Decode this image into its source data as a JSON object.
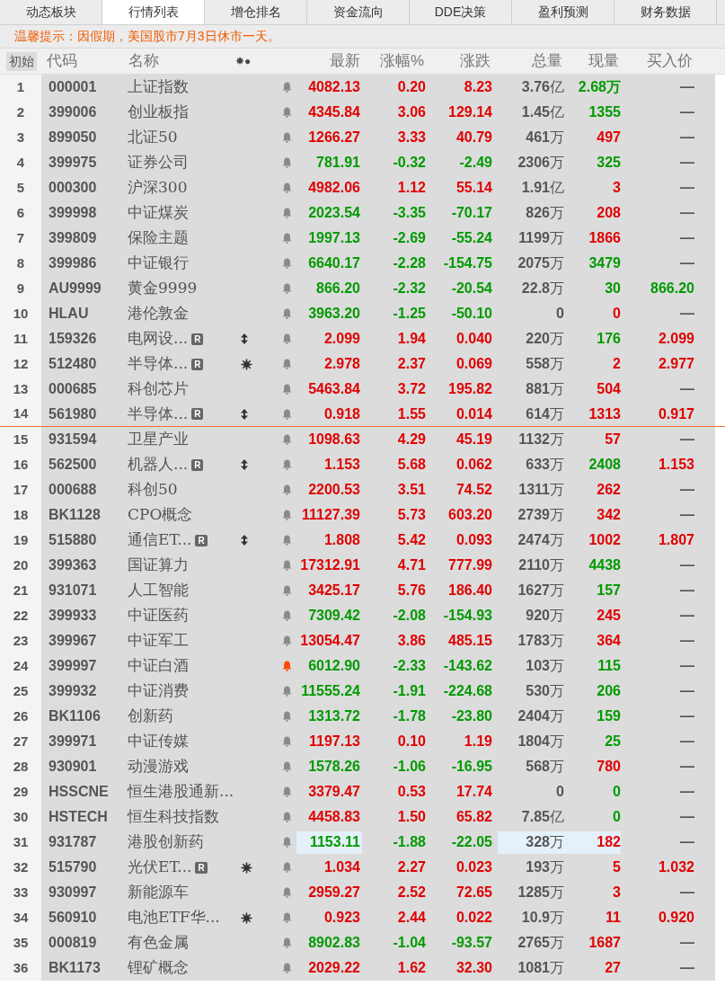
{
  "tabs": [
    {
      "label": "动态板块",
      "selected": false
    },
    {
      "label": "行情列表",
      "selected": true
    },
    {
      "label": "增仓排名",
      "selected": false
    },
    {
      "label": "资金流向",
      "selected": false
    },
    {
      "label": "DDE决策",
      "selected": false
    },
    {
      "label": "盈利预测",
      "selected": false
    },
    {
      "label": "财务数据",
      "selected": false
    }
  ],
  "notice": "温馨提示：因假期，美国股市7月3日休市一天。",
  "columns": {
    "index": "初始",
    "code": "代码",
    "name": "名称",
    "marker": "✸●",
    "latest": "最新",
    "pct": "涨幅%",
    "change": "涨跌",
    "volume": "总量",
    "now": "现量",
    "buy": "买入价"
  },
  "rows": [
    {
      "index": "1",
      "code": "000001",
      "name": "上证指数",
      "updown": false,
      "star": false,
      "alert": false,
      "latest": "4082.13",
      "pct": "0.20",
      "change": "8.23",
      "volume": "3.76亿",
      "now": "2.68万",
      "buy_side": false,
      "buy": "—",
      "rising": true,
      "flash": false,
      "divider_below": false
    },
    {
      "index": "2",
      "code": "399006",
      "name": "创业板指",
      "updown": false,
      "star": false,
      "alert": false,
      "latest": "4345.84",
      "pct": "3.06",
      "change": "129.14",
      "volume": "1.45亿",
      "now": "1355",
      "buy_side": false,
      "buy": "—",
      "rising": true,
      "flash": false,
      "divider_below": false
    },
    {
      "index": "3",
      "code": "899050",
      "name": "北证50",
      "updown": false,
      "star": false,
      "alert": false,
      "latest": "1266.27",
      "pct": "3.33",
      "change": "40.79",
      "volume": "461万",
      "now": "497",
      "buy_side": true,
      "buy": "—",
      "rising": true,
      "flash": false,
      "divider_below": false
    },
    {
      "index": "4",
      "code": "399975",
      "name": "证券公司",
      "updown": false,
      "star": false,
      "alert": false,
      "latest": "781.91",
      "pct": "-0.32",
      "change": "-2.49",
      "volume": "2306万",
      "now": "325",
      "buy_side": false,
      "buy": "—",
      "rising": false,
      "flash": false,
      "divider_below": false
    },
    {
      "index": "5",
      "code": "000300",
      "name": "沪深300",
      "updown": false,
      "star": false,
      "alert": false,
      "latest": "4982.06",
      "pct": "1.12",
      "change": "55.14",
      "volume": "1.91亿",
      "now": "3",
      "buy_side": true,
      "buy": "—",
      "rising": true,
      "flash": false,
      "divider_below": false
    },
    {
      "index": "6",
      "code": "399998",
      "name": "中证煤炭",
      "updown": false,
      "star": false,
      "alert": false,
      "latest": "2023.54",
      "pct": "-3.35",
      "change": "-70.17",
      "volume": "826万",
      "now": "208",
      "buy_side": true,
      "buy": "—",
      "rising": false,
      "flash": false,
      "divider_below": false
    },
    {
      "index": "7",
      "code": "399809",
      "name": "保险主题",
      "updown": false,
      "star": false,
      "alert": false,
      "latest": "1997.13",
      "pct": "-2.69",
      "change": "-55.24",
      "volume": "1199万",
      "now": "1866",
      "buy_side": true,
      "buy": "—",
      "rising": false,
      "flash": false,
      "divider_below": false
    },
    {
      "index": "8",
      "code": "399986",
      "name": "中证银行",
      "updown": false,
      "star": false,
      "alert": false,
      "latest": "6640.17",
      "pct": "-2.28",
      "change": "-154.75",
      "volume": "2075万",
      "now": "3479",
      "buy_side": false,
      "buy": "—",
      "rising": false,
      "flash": false,
      "divider_below": false
    },
    {
      "index": "9",
      "code": "AU9999",
      "name": "黄金9999",
      "updown": false,
      "star": false,
      "alert": false,
      "latest": "866.20",
      "pct": "-2.32",
      "change": "-20.54",
      "volume": "22.8万",
      "now": "30",
      "buy_side": false,
      "buy": "866.20",
      "rising": false,
      "flash": false,
      "divider_below": false
    },
    {
      "index": "10",
      "code": "HLAU",
      "name": "港伦敦金",
      "updown": false,
      "star": false,
      "alert": false,
      "latest": "3963.20",
      "pct": "-1.25",
      "change": "-50.10",
      "volume": "0",
      "now": "0",
      "buy_side": true,
      "buy": "—",
      "rising": false,
      "flash": false,
      "divider_below": false
    },
    {
      "index": "11",
      "code": "159326",
      "name": "电网设...",
      "badge": "R",
      "updown": true,
      "star": false,
      "alert": false,
      "latest": "2.099",
      "pct": "1.94",
      "change": "0.040",
      "volume": "220万",
      "now": "176",
      "buy_side": false,
      "buy": "2.099",
      "rising": true,
      "flash": false,
      "divider_below": false
    },
    {
      "index": "12",
      "code": "512480",
      "name": "半导体...",
      "badge": "R",
      "updown": false,
      "star": true,
      "alert": false,
      "latest": "2.978",
      "pct": "2.37",
      "change": "0.069",
      "volume": "558万",
      "now": "2",
      "buy_side": true,
      "buy": "2.977",
      "rising": true,
      "flash": false,
      "divider_below": false
    },
    {
      "index": "13",
      "code": "000685",
      "name": "科创芯片",
      "updown": false,
      "star": false,
      "alert": false,
      "latest": "5463.84",
      "pct": "3.72",
      "change": "195.82",
      "volume": "881万",
      "now": "504",
      "buy_side": true,
      "buy": "—",
      "rising": true,
      "flash": false,
      "divider_below": false
    },
    {
      "index": "14",
      "code": "561980",
      "name": "半导体...",
      "badge": "R",
      "updown": true,
      "star": false,
      "alert": false,
      "latest": "0.918",
      "pct": "1.55",
      "change": "0.014",
      "volume": "614万",
      "now": "1313",
      "buy_side": true,
      "buy": "0.917",
      "rising": true,
      "flash": false,
      "divider_below": true
    },
    {
      "index": "15",
      "code": "931594",
      "name": "卫星产业",
      "updown": false,
      "star": false,
      "alert": false,
      "latest": "1098.63",
      "pct": "4.29",
      "change": "45.19",
      "volume": "1132万",
      "now": "57",
      "buy_side": true,
      "buy": "—",
      "rising": true,
      "flash": false,
      "divider_below": false
    },
    {
      "index": "16",
      "code": "562500",
      "name": "机器人...",
      "badge": "R",
      "updown": true,
      "star": false,
      "alert": false,
      "latest": "1.153",
      "pct": "5.68",
      "change": "0.062",
      "volume": "633万",
      "now": "2408",
      "buy_side": false,
      "buy": "1.153",
      "rising": true,
      "flash": false,
      "divider_below": false
    },
    {
      "index": "17",
      "code": "000688",
      "name": "科创50",
      "updown": false,
      "star": false,
      "alert": false,
      "latest": "2200.53",
      "pct": "3.51",
      "change": "74.52",
      "volume": "1311万",
      "now": "262",
      "buy_side": true,
      "buy": "—",
      "rising": true,
      "flash": false,
      "divider_below": false
    },
    {
      "index": "18",
      "code": "BK1128",
      "name": "CPO概念",
      "updown": false,
      "star": false,
      "alert": false,
      "latest": "11127.39",
      "pct": "5.73",
      "change": "603.20",
      "volume": "2739万",
      "now": "342",
      "buy_side": true,
      "buy": "—",
      "rising": true,
      "flash": false,
      "divider_below": false
    },
    {
      "index": "19",
      "code": "515880",
      "name": "通信ET...",
      "badge": "R",
      "updown": true,
      "star": false,
      "alert": false,
      "latest": "1.808",
      "pct": "5.42",
      "change": "0.093",
      "volume": "2474万",
      "now": "1002",
      "buy_side": true,
      "buy": "1.807",
      "rising": true,
      "flash": false,
      "divider_below": false
    },
    {
      "index": "20",
      "code": "399363",
      "name": "国证算力",
      "updown": false,
      "star": false,
      "alert": false,
      "latest": "17312.91",
      "pct": "4.71",
      "change": "777.99",
      "volume": "2110万",
      "now": "4438",
      "buy_side": false,
      "buy": "—",
      "rising": true,
      "flash": false,
      "divider_below": false
    },
    {
      "index": "21",
      "code": "931071",
      "name": "人工智能",
      "updown": false,
      "star": false,
      "alert": false,
      "latest": "3425.17",
      "pct": "5.76",
      "change": "186.40",
      "volume": "1627万",
      "now": "157",
      "buy_side": false,
      "buy": "—",
      "rising": true,
      "flash": false,
      "divider_below": false
    },
    {
      "index": "22",
      "code": "399933",
      "name": "中证医药",
      "updown": false,
      "star": false,
      "alert": false,
      "latest": "7309.42",
      "pct": "-2.08",
      "change": "-154.93",
      "volume": "920万",
      "now": "245",
      "buy_side": true,
      "buy": "—",
      "rising": false,
      "flash": false,
      "divider_below": false
    },
    {
      "index": "23",
      "code": "399967",
      "name": "中证军工",
      "updown": false,
      "star": false,
      "alert": false,
      "latest": "13054.47",
      "pct": "3.86",
      "change": "485.15",
      "volume": "1783万",
      "now": "364",
      "buy_side": true,
      "buy": "—",
      "rising": true,
      "flash": false,
      "divider_below": false
    },
    {
      "index": "24",
      "code": "399997",
      "name": "中证白酒",
      "updown": false,
      "star": false,
      "alert": true,
      "latest": "6012.90",
      "pct": "-2.33",
      "change": "-143.62",
      "volume": "103万",
      "now": "115",
      "buy_side": false,
      "buy": "—",
      "rising": false,
      "flash": false,
      "divider_below": false
    },
    {
      "index": "25",
      "code": "399932",
      "name": "中证消费",
      "updown": false,
      "star": false,
      "alert": false,
      "latest": "11555.24",
      "pct": "-1.91",
      "change": "-224.68",
      "volume": "530万",
      "now": "206",
      "buy_side": false,
      "buy": "—",
      "rising": false,
      "flash": false,
      "divider_below": false
    },
    {
      "index": "26",
      "code": "BK1106",
      "name": "创新药",
      "updown": false,
      "star": false,
      "alert": false,
      "latest": "1313.72",
      "pct": "-1.78",
      "change": "-23.80",
      "volume": "2404万",
      "now": "159",
      "buy_side": false,
      "buy": "—",
      "rising": false,
      "flash": false,
      "divider_below": false
    },
    {
      "index": "27",
      "code": "399971",
      "name": "中证传媒",
      "updown": false,
      "star": false,
      "alert": false,
      "latest": "1197.13",
      "pct": "0.10",
      "change": "1.19",
      "volume": "1804万",
      "now": "25",
      "buy_side": false,
      "buy": "—",
      "rising": true,
      "flash": false,
      "divider_below": false
    },
    {
      "index": "28",
      "code": "930901",
      "name": "动漫游戏",
      "updown": false,
      "star": false,
      "alert": false,
      "latest": "1578.26",
      "pct": "-1.06",
      "change": "-16.95",
      "volume": "568万",
      "now": "780",
      "buy_side": true,
      "buy": "—",
      "rising": false,
      "flash": false,
      "divider_below": false
    },
    {
      "index": "29",
      "code": "HSSCNE",
      "name": "恒生港股通新...",
      "updown": false,
      "star": false,
      "alert": false,
      "latest": "3379.47",
      "pct": "0.53",
      "change": "17.74",
      "volume": "0",
      "now": "0",
      "buy_side": false,
      "buy": "—",
      "rising": true,
      "flash": false,
      "divider_below": false
    },
    {
      "index": "30",
      "code": "HSTECH",
      "name": "恒生科技指数",
      "updown": false,
      "star": false,
      "alert": false,
      "latest": "4458.83",
      "pct": "1.50",
      "change": "65.82",
      "volume": "7.85亿",
      "now": "0",
      "buy_side": false,
      "buy": "—",
      "rising": true,
      "flash": false,
      "divider_below": false
    },
    {
      "index": "31",
      "code": "931787",
      "name": "港股创新药",
      "updown": false,
      "star": false,
      "alert": false,
      "latest": "1153.11",
      "pct": "-1.88",
      "change": "-22.05",
      "volume": "328万",
      "now": "182",
      "buy_side": true,
      "buy": "—",
      "rising": false,
      "flash": true,
      "divider_below": false
    },
    {
      "index": "32",
      "code": "515790",
      "name": "光伏ET...",
      "badge": "R",
      "updown": false,
      "star": true,
      "alert": false,
      "latest": "1.034",
      "pct": "2.27",
      "change": "0.023",
      "volume": "193万",
      "now": "5",
      "buy_side": true,
      "buy": "1.032",
      "rising": true,
      "flash": false,
      "divider_below": false
    },
    {
      "index": "33",
      "code": "930997",
      "name": "新能源车",
      "updown": false,
      "star": false,
      "alert": false,
      "latest": "2959.27",
      "pct": "2.52",
      "change": "72.65",
      "volume": "1285万",
      "now": "3",
      "buy_side": true,
      "buy": "—",
      "rising": true,
      "flash": false,
      "divider_below": false
    },
    {
      "index": "34",
      "code": "560910",
      "name": "电池ETF华...",
      "updown": false,
      "star": true,
      "alert": false,
      "latest": "0.923",
      "pct": "2.44",
      "change": "0.022",
      "volume": "10.9万",
      "now": "11",
      "buy_side": true,
      "buy": "0.920",
      "rising": true,
      "flash": false,
      "divider_below": false
    },
    {
      "index": "35",
      "code": "000819",
      "name": "有色金属",
      "updown": false,
      "star": false,
      "alert": false,
      "latest": "8902.83",
      "pct": "-1.04",
      "change": "-93.57",
      "volume": "2765万",
      "now": "1687",
      "buy_side": true,
      "buy": "—",
      "rising": false,
      "flash": false,
      "divider_below": false
    },
    {
      "index": "36",
      "code": "BK1173",
      "name": "锂矿概念",
      "updown": false,
      "star": false,
      "alert": false,
      "latest": "2029.22",
      "pct": "1.62",
      "change": "32.30",
      "volume": "1081万",
      "now": "27",
      "buy_side": true,
      "buy": "—",
      "rising": true,
      "flash": false,
      "divider_below": false
    }
  ]
}
